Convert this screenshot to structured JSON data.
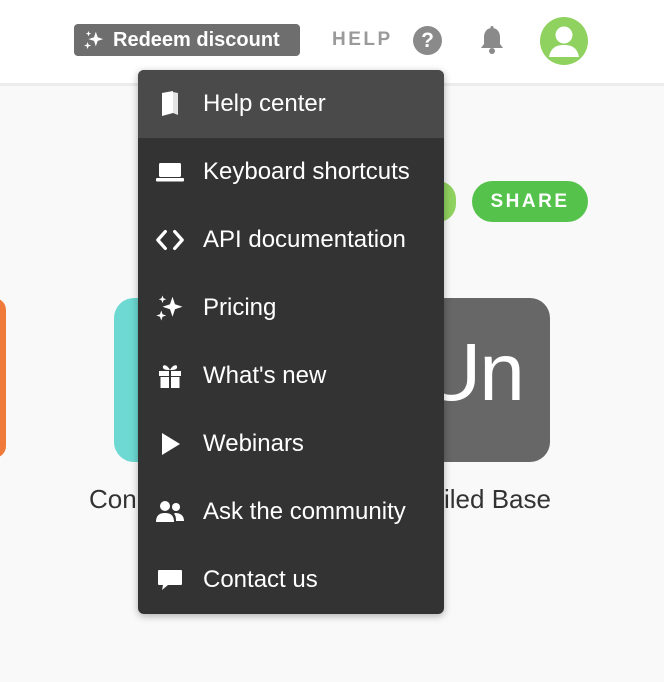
{
  "header": {
    "redeem_label": "Redeem discount",
    "help_label": "HELP",
    "help_icon_glyph": "?"
  },
  "background": {
    "share_label": "SHARE",
    "tile_gray_text": "Un",
    "label_left": "Con",
    "label_right": "iled Base"
  },
  "menu": {
    "items": [
      {
        "label": "Help center",
        "icon": "book-icon"
      },
      {
        "label": "Keyboard shortcuts",
        "icon": "laptop-icon"
      },
      {
        "label": "API documentation",
        "icon": "code-icon"
      },
      {
        "label": "Pricing",
        "icon": "sparkles-icon"
      },
      {
        "label": "What's new",
        "icon": "gift-icon"
      },
      {
        "label": "Webinars",
        "icon": "play-icon"
      },
      {
        "label": "Ask the community",
        "icon": "users-icon"
      },
      {
        "label": "Contact us",
        "icon": "chat-icon"
      }
    ]
  },
  "colors": {
    "menu_bg": "#333333",
    "menu_active": "#4a4a4a",
    "share_green": "#54c24b",
    "avatar_green": "#8fd25f",
    "teal": "#6dd9d2",
    "orange": "#f07a3a"
  }
}
